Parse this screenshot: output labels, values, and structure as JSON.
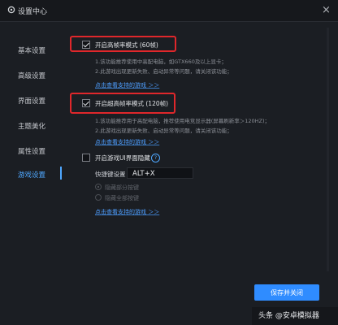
{
  "window": {
    "title": "设置中心",
    "close_label": "×"
  },
  "sidebar": {
    "items": [
      {
        "label": "基本设置"
      },
      {
        "label": "高级设置"
      },
      {
        "label": "界面设置"
      },
      {
        "label": "主题美化"
      },
      {
        "label": "属性设置"
      },
      {
        "label": "游戏设置",
        "active": true
      }
    ]
  },
  "game_settings": {
    "option1": {
      "label": "开启高帧率模式 (60帧)",
      "checked": true,
      "notes": [
        "1.该功能推荐使用中高配电脑，如GTX660及以上显卡；",
        "2.此游戏出现更新失败、启动异常等问题，请关闭该功能；"
      ],
      "link": "点击查看支持的游戏 ＞＞"
    },
    "option2": {
      "label": "开启超高帧率模式 (120帧)",
      "checked": true,
      "notes": [
        "1.该功能推荐用于高配电脑，推荐使用电竞显示器(屏幕刷新率＞120HZ)；",
        "2.此游戏出现更新失败、启动异常等问题，请关闭该功能；"
      ],
      "link": "点击查看支持的游戏 ＞＞"
    },
    "option3": {
      "label": "开启游戏UI界面隐藏",
      "checked": false,
      "help": "?"
    },
    "shortcut": {
      "label": "快捷键设置",
      "value": "ALT+X"
    },
    "radios": [
      "隐藏部分按键",
      "隐藏全部按键"
    ],
    "link3": "点击查看支持的游戏 ＞＞"
  },
  "footer": {
    "save_label": "保存并关闭"
  },
  "watermark": {
    "text": "头条 @安卓模拟器"
  },
  "colors": {
    "accent": "#2f8cff",
    "highlight": "#e0272b",
    "bg": "#1b1e23"
  }
}
